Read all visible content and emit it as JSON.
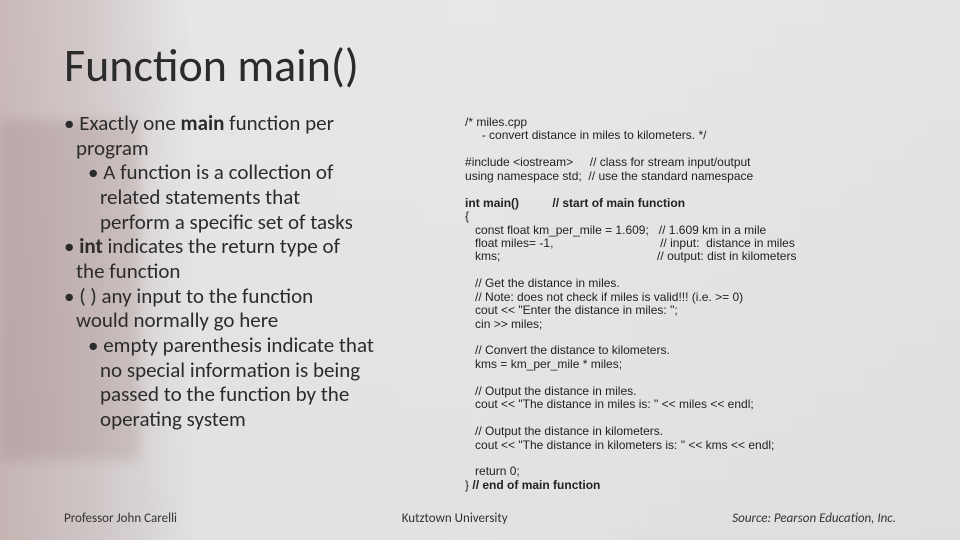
{
  "title": "Function main()",
  "bullets": {
    "b1_pre": "Exactly one ",
    "b1_bold": "main",
    "b1_post": " function per",
    "b1_cont": "program",
    "b1a_l1": "A function is a collection of",
    "b1a_l2": "related statements that",
    "b1a_l3": "perform a specific set of tasks",
    "b2_bold": "int",
    "b2_post": " indicates the return type of",
    "b2_cont": "the function",
    "b3_l1": "(  ) any input to the function",
    "b3_l2": "would normally go here",
    "b3a_l1": "empty parenthesis indicate that",
    "b3a_l2": "no special information is being",
    "b3a_l3": "passed to the function by the",
    "b3a_l4": "operating system"
  },
  "code": {
    "l00": "/* miles.cpp",
    "l01": "     - convert distance in miles to kilometers. */",
    "l02": "",
    "l03": "#include <iostream>     // class for stream input/output",
    "l04": "using namespace std;  // use the standard namespace",
    "l05": "",
    "l06a": "int main()",
    "l06b": "          // start of main function",
    "l07": "{",
    "l08": "   const float km_per_mile = 1.609;   // 1.609 km in a mile",
    "l09": "   float miles= -1,                                // input:  distance in miles",
    "l10": "   kms;                                               // output: dist in kilometers",
    "l11": "",
    "l12": "   // Get the distance in miles.",
    "l13": "   // Note: does not check if miles is valid!!! (i.e. >= 0)",
    "l14": "   cout << \"Enter the distance in miles: \";",
    "l15": "   cin >> miles;",
    "l16": "",
    "l17": "   // Convert the distance to kilometers.",
    "l18": "   kms = km_per_mile * miles;",
    "l19": "",
    "l20": "   // Output the distance in miles.",
    "l21": "   cout << \"The distance in miles is: \" << miles << endl;",
    "l22": "",
    "l23": "   // Output the distance in kilometers.",
    "l24": "   cout << \"The distance in kilometers is: \" << kms << endl;",
    "l25": "",
    "l26": "   return 0;",
    "l27a": "} ",
    "l27b": "// end of main function"
  },
  "footer": {
    "left": "Professor John Carelli",
    "center": "Kutztown University",
    "right": "Source: Pearson Education, Inc."
  }
}
